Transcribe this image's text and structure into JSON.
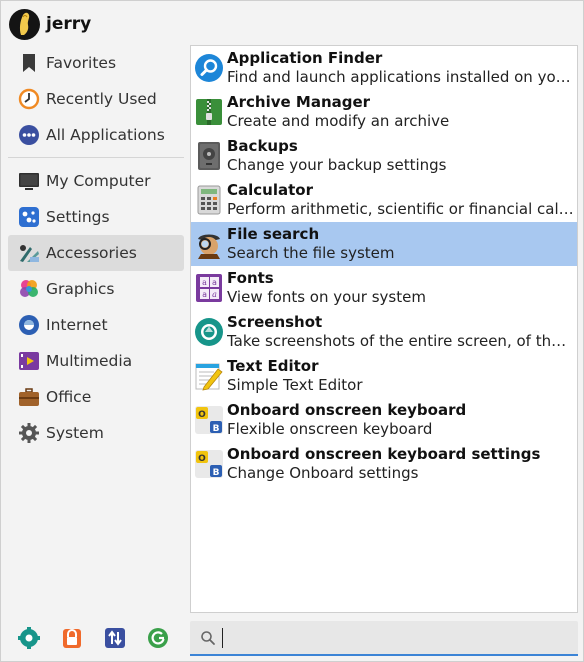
{
  "user": {
    "name": "jerry"
  },
  "sidebar": {
    "items": [
      {
        "label": "Favorites",
        "icon": "bookmark-icon"
      },
      {
        "label": "Recently Used",
        "icon": "clock-icon"
      },
      {
        "label": "All Applications",
        "icon": "apps-icon"
      }
    ],
    "categories": [
      {
        "label": "My Computer",
        "icon": "monitor-icon"
      },
      {
        "label": "Settings",
        "icon": "settings-sliders-icon"
      },
      {
        "label": "Accessories",
        "icon": "accessories-icon",
        "active": true
      },
      {
        "label": "Graphics",
        "icon": "graphics-icon"
      },
      {
        "label": "Internet",
        "icon": "internet-icon"
      },
      {
        "label": "Multimedia",
        "icon": "multimedia-icon"
      },
      {
        "label": "Office",
        "icon": "briefcase-icon"
      },
      {
        "label": "System",
        "icon": "gear-icon"
      }
    ]
  },
  "apps": [
    {
      "name": "Application Finder",
      "desc": "Find and launch applications installed on your system",
      "icon": "app-finder-icon"
    },
    {
      "name": "Archive Manager",
      "desc": "Create and modify an archive",
      "icon": "archive-icon"
    },
    {
      "name": "Backups",
      "desc": "Change your backup settings",
      "icon": "backup-icon"
    },
    {
      "name": "Calculator",
      "desc": "Perform arithmetic, scientific or financial calculations",
      "icon": "calculator-icon"
    },
    {
      "name": "File search",
      "desc": "Search the file system",
      "icon": "file-search-icon",
      "selected": true
    },
    {
      "name": "Fonts",
      "desc": "View fonts on your system",
      "icon": "fonts-icon"
    },
    {
      "name": "Screenshot",
      "desc": "Take screenshots of the entire screen, of the active window or of a region",
      "icon": "screenshot-icon"
    },
    {
      "name": "Text Editor",
      "desc": "Simple Text Editor",
      "icon": "text-editor-icon"
    },
    {
      "name": "Onboard onscreen keyboard",
      "desc": "Flexible onscreen keyboard",
      "icon": "onboard-icon"
    },
    {
      "name": "Onboard onscreen keyboard settings",
      "desc": "Change Onboard settings",
      "icon": "onboard-settings-icon"
    }
  ],
  "bottom": {
    "buttons": [
      "settings-manager-icon",
      "lock-icon",
      "switch-user-icon",
      "logout-icon"
    ]
  },
  "search": {
    "value": "",
    "placeholder": ""
  },
  "colors": {
    "selection": "#a8c8f0",
    "accent": "#3c84d6",
    "active_category": "#dcdcdc"
  }
}
